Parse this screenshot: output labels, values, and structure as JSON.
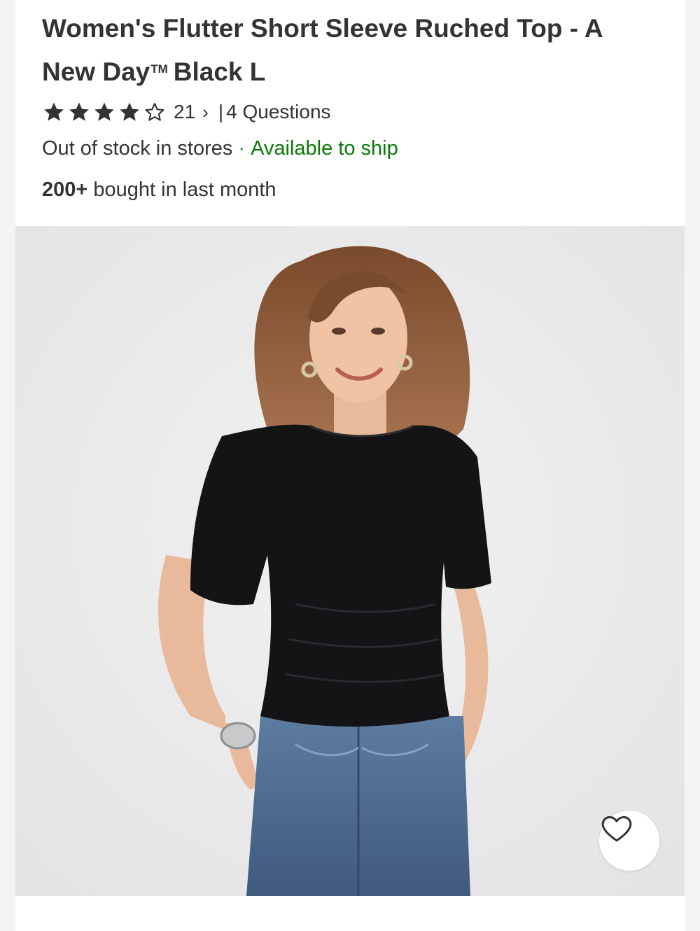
{
  "product": {
    "title_main": "Women's Flutter Short Sleeve Ruched Top - A New Day",
    "trademark": "TM",
    "title_variant": "Black L"
  },
  "rating": {
    "stars": 4,
    "max_stars": 5,
    "review_count": "21",
    "chevron": "›",
    "separator": "|",
    "questions": "4 Questions"
  },
  "fulfillment": {
    "store_status": "Out of stock in stores",
    "dot": "·",
    "ship_status": "Available to ship",
    "ship_color": "#0a7a0a"
  },
  "social_proof": {
    "count": "200+",
    "text": " bought in last month"
  },
  "image": {
    "icon": "product-photo",
    "favorite_icon": "heart-outline-icon"
  }
}
